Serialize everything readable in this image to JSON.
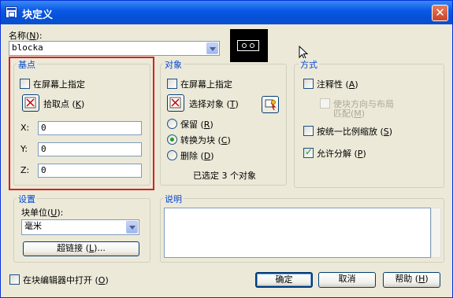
{
  "window": {
    "title": "块定义",
    "close": "✕"
  },
  "name_label": {
    "text": "名称",
    "key": "N",
    "close": "):"
  },
  "name_value": "blocka",
  "base_point": {
    "title": "基点",
    "on_screen": "在屏幕上指定",
    "pick_point": "拾取点",
    "pick_key": "K",
    "x_label": "X:",
    "x_value": "0",
    "y_label": "Y:",
    "y_value": "0",
    "z_label": "Z:",
    "z_value": "0"
  },
  "objects": {
    "title": "对象",
    "on_screen": "在屏幕上指定",
    "select_objects": "选择对象",
    "select_key": "T",
    "retain": "保留",
    "retain_key": "R",
    "convert": "转换为块",
    "convert_key": "C",
    "delete": "删除",
    "delete_key": "D",
    "selected_count": "已选定 3 个对象"
  },
  "behavior": {
    "title": "方式",
    "annotative": "注释性",
    "annotative_key": "A",
    "match_orientation_1": "使块方向与布局",
    "match_orientation_2": "匹配",
    "match_key": "M",
    "scale_uniformly": "按统一比例缩放",
    "scale_key": "S",
    "allow_explode": "允许分解",
    "explode_key": "P"
  },
  "settings": {
    "title": "设置",
    "unit_label": "块单位",
    "unit_key": "U",
    "unit_value": "毫米",
    "hyperlink": "超链接",
    "hyperlink_key": "L"
  },
  "description": {
    "title": "说明"
  },
  "footer": {
    "open_in_editor": "在块编辑器中打开",
    "open_key": "O",
    "ok": "确定",
    "cancel": "取消",
    "help": "帮助",
    "help_key": "H"
  },
  "colors": {
    "title_bar": "#0a5ae8",
    "group_label": "#0046d5",
    "highlight_box": "#d42222",
    "face": "#ece9d8"
  }
}
